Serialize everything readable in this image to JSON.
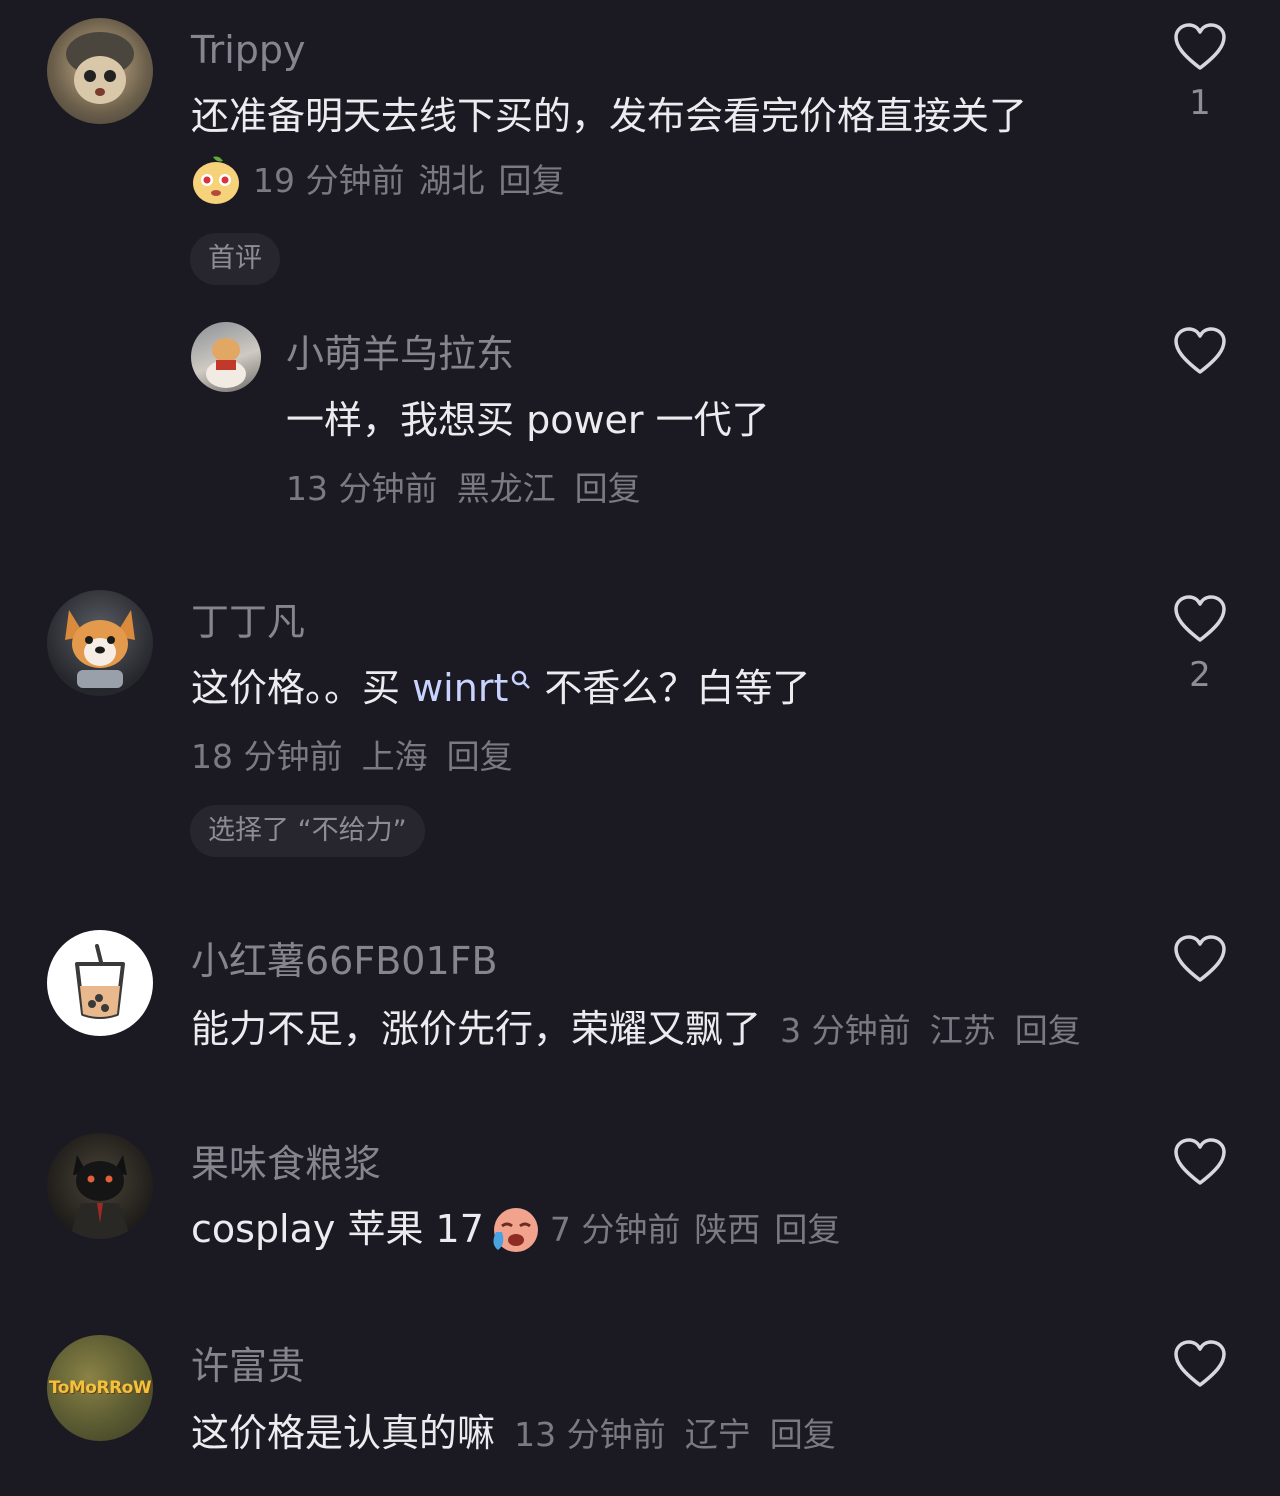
{
  "comments": [
    {
      "username": "Trippy",
      "text": "还准备明天去线下买的，发布会看完价格直接关了",
      "time": "19 分钟前",
      "location": "湖北",
      "reply": "回复",
      "tag": "首评",
      "likes": "1",
      "icon": "cat-pilot-avatar",
      "replies": [
        {
          "username": "小萌羊乌拉东",
          "text": "一样，我想买 power 一代了",
          "time": "13 分钟前",
          "location": "黑龙江",
          "reply": "回复",
          "icon": "dog-photo-avatar"
        }
      ]
    },
    {
      "username": "丁丁凡",
      "text_before": "这价格。。买 ",
      "link": "winrt",
      "text_after": " 不香么？白等了",
      "time": "18 分钟前",
      "location": "上海",
      "reply": "回复",
      "tag": "选择了 “不给力”",
      "likes": "2",
      "icon": "corgi-avatar"
    },
    {
      "username": "小红薯66FB01FB",
      "text": "能力不足，涨价先行，荣耀又飘了",
      "time": "3 分钟前",
      "location": "江苏",
      "reply": "回复",
      "icon": "bubble-tea-avatar"
    },
    {
      "username": "果味食粮浆",
      "text": "cosplay 苹果 17",
      "time": "7 分钟前",
      "location": "陕西",
      "reply": "回复",
      "icon": "black-cat-avatar"
    },
    {
      "username": "许富贵",
      "text": "这价格是认真的嘛",
      "time": "13 分钟前",
      "location": "辽宁",
      "reply": "回复",
      "icon": "tomorrow-avatar",
      "avatar_text": "ToMoRRoW"
    }
  ],
  "colors": {
    "background": "#1b1a22",
    "username": "#86858e",
    "text": "#ececf0",
    "meta": "#7b7a83"
  }
}
